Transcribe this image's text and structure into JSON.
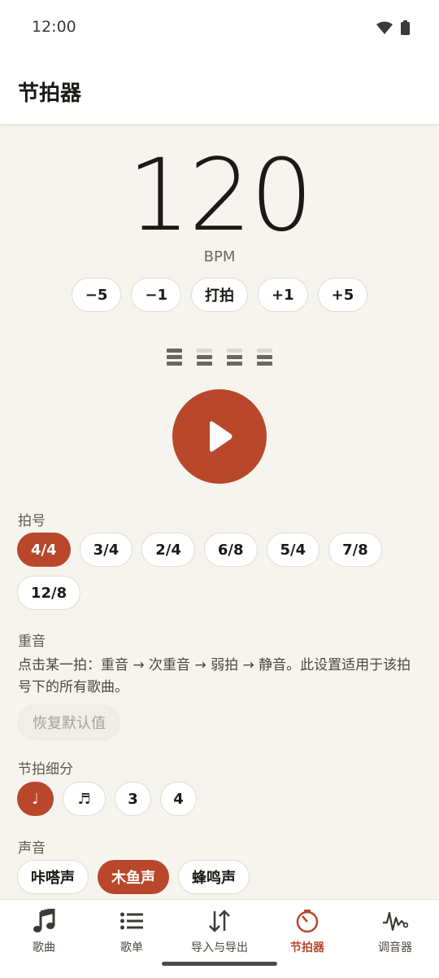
{
  "status_bar": {
    "time": "12:00"
  },
  "app_bar": {
    "title": "节拍器"
  },
  "tempo": {
    "bpm": "120",
    "unit": "BPM",
    "adjust_buttons": [
      "−5",
      "−1",
      "打拍",
      "+1",
      "+5"
    ]
  },
  "beat_indicators": [
    {
      "level": "accent"
    },
    {
      "level": "normal"
    },
    {
      "level": "normal"
    },
    {
      "level": "normal"
    }
  ],
  "play_button": {
    "icon": "play-icon"
  },
  "time_signature": {
    "label": "拍号",
    "options": [
      "4/4",
      "3/4",
      "2/4",
      "6/8",
      "5/4",
      "7/8",
      "12/8"
    ],
    "selected": "4/4"
  },
  "accent": {
    "label": "重音",
    "description": "点击某一拍：重音 → 次重音 → 弱拍 → 静音。此设置适用于该拍号下的所有歌曲。",
    "reset_label": "恢复默认值"
  },
  "subdivision": {
    "label": "节拍细分",
    "options": [
      "♩",
      "♬",
      "3",
      "4"
    ],
    "selected": "♩"
  },
  "sound": {
    "label": "声音",
    "options": [
      "咔嗒声",
      "木鱼声",
      "蜂鸣声"
    ],
    "selected": "木鱼声"
  },
  "bottom_nav": {
    "items": [
      {
        "label": "歌曲",
        "icon": "music-note-icon"
      },
      {
        "label": "歌单",
        "icon": "list-icon"
      },
      {
        "label": "导入与导出",
        "icon": "import-export-icon"
      },
      {
        "label": "节拍器",
        "icon": "metronome-icon"
      },
      {
        "label": "调音器",
        "icon": "waveform-icon"
      }
    ],
    "active": "节拍器"
  },
  "colors": {
    "accent": "#b9472b",
    "background": "#f6f4ef",
    "surface": "#ffffff"
  }
}
